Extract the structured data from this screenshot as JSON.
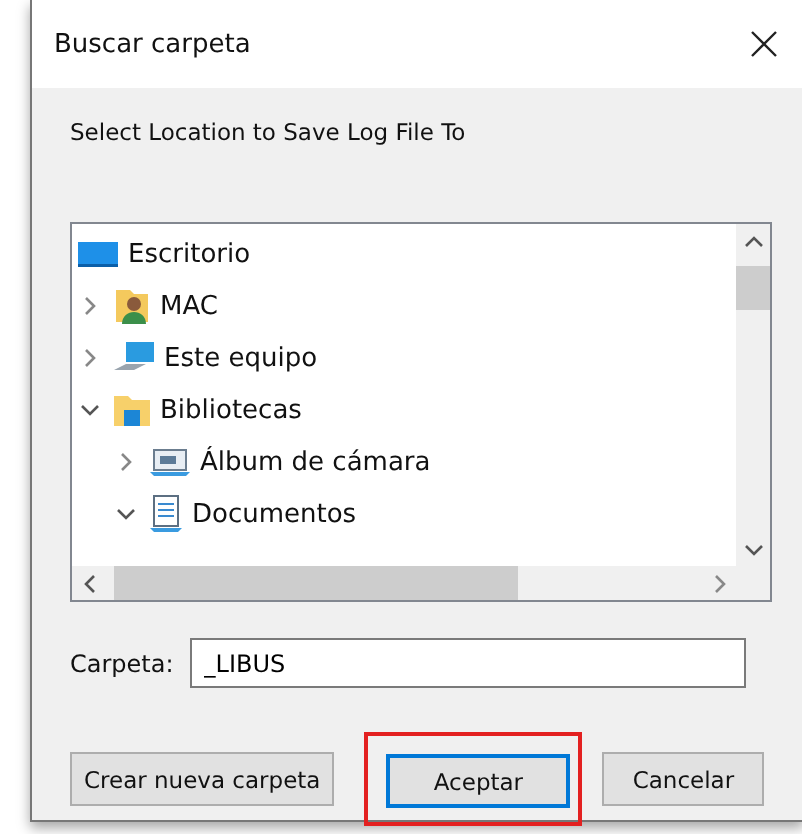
{
  "window": {
    "title": "Buscar carpeta"
  },
  "instruction": "Select Location to Save Log File To",
  "tree": [
    {
      "label": "Escritorio",
      "kind": "desktop",
      "children": [
        {
          "label": "MAC",
          "kind": "user",
          "expanded": false
        },
        {
          "label": "Este equipo",
          "kind": "computer",
          "expanded": false
        },
        {
          "label": "Bibliotecas",
          "kind": "library",
          "expanded": true,
          "children": [
            {
              "label": "Álbum de cámara",
              "kind": "pictures",
              "expanded": false
            },
            {
              "label": "Documentos",
              "kind": "documents",
              "expanded": true
            }
          ]
        }
      ]
    }
  ],
  "folder": {
    "label": "Carpeta:",
    "value": "_LIBUS"
  },
  "buttons": [
    {
      "label": "Crear nueva carpeta",
      "default": false,
      "highlighted": false
    },
    {
      "label": "Aceptar",
      "default": true,
      "highlighted": true
    },
    {
      "label": "Cancelar",
      "default": false,
      "highlighted": false
    }
  ]
}
